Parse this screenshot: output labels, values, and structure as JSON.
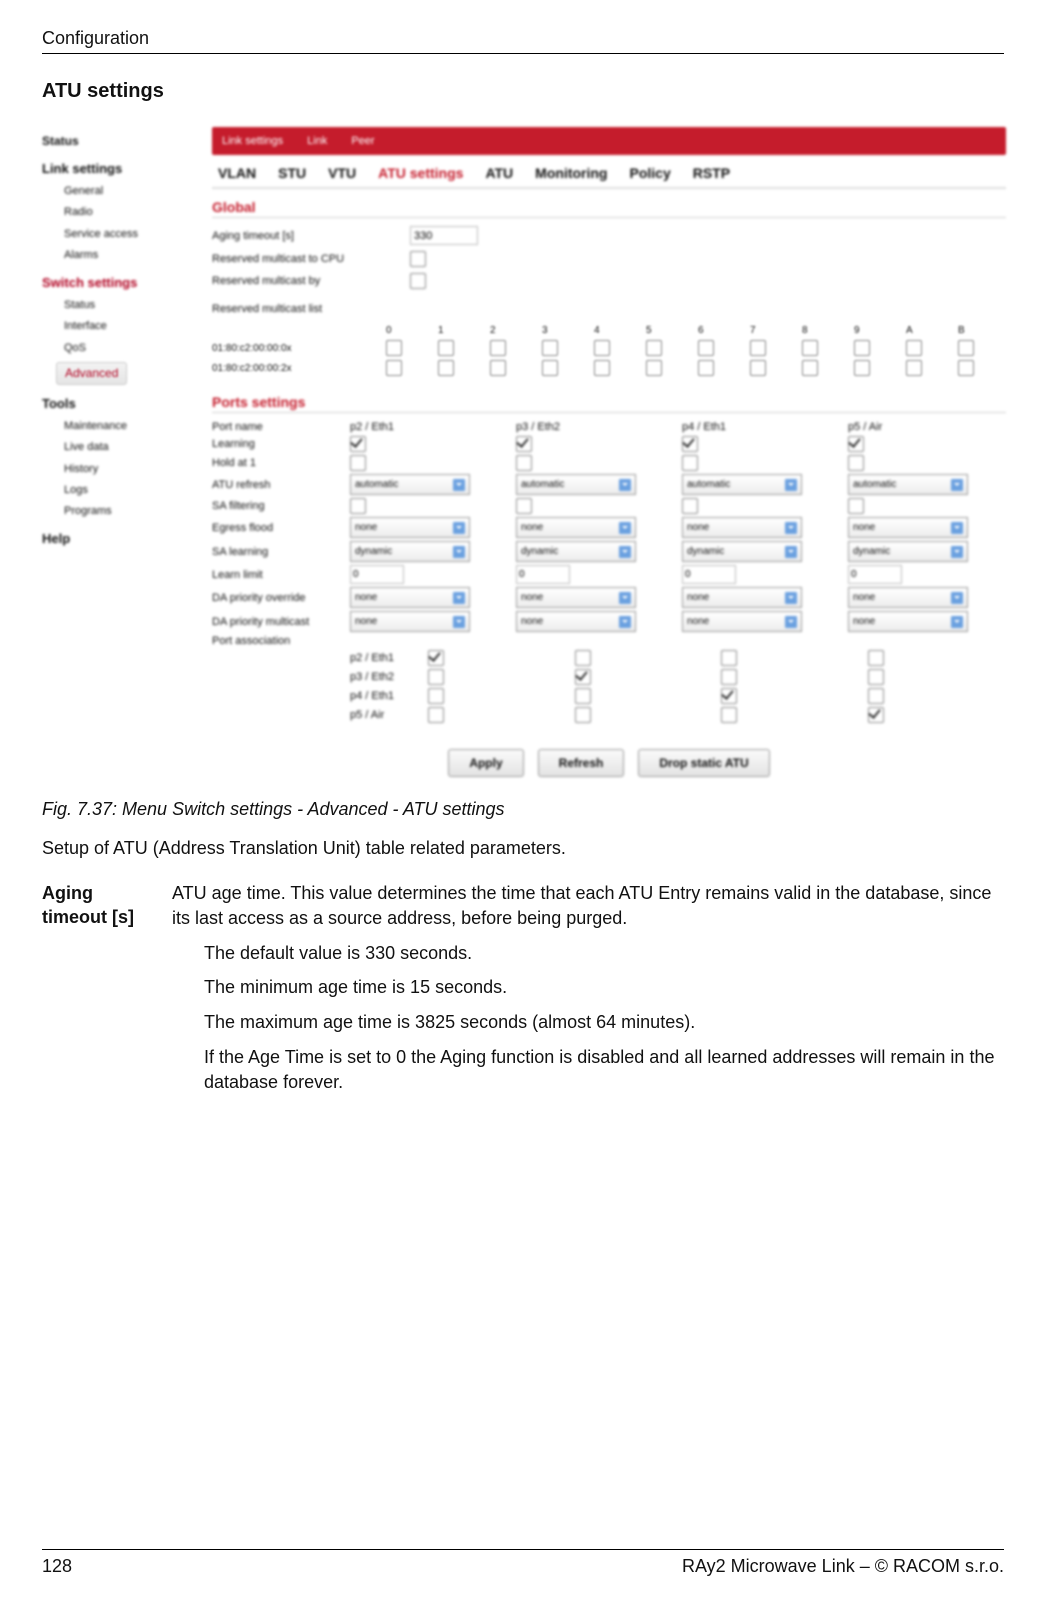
{
  "header": {
    "running": "Configuration",
    "title": "ATU settings"
  },
  "sidebar": {
    "top": "Status",
    "groups": [
      {
        "label": "Link settings",
        "active": false,
        "items": [
          "General",
          "Radio",
          "Service access",
          "Alarms"
        ]
      },
      {
        "label": "Switch settings",
        "active": true,
        "items": [
          "Status",
          "Interface",
          "QoS",
          "Advanced"
        ],
        "activeItem": "Advanced"
      },
      {
        "label": "Tools",
        "active": false,
        "items": [
          "Maintenance",
          "Live data",
          "History",
          "Logs",
          "Programs"
        ]
      }
    ],
    "help": "Help"
  },
  "screenshot": {
    "topbar": [
      "Link settings",
      "Link",
      "Peer"
    ],
    "tabs": [
      "VLAN",
      "STU",
      "VTU",
      "ATU settings",
      "ATU",
      "Monitoring",
      "Policy",
      "RSTP"
    ],
    "activeTab": "ATU settings",
    "globalHeading": "Global",
    "global": {
      "aging_label": "Aging timeout [s]",
      "aging_value": "330",
      "learn2all_label": "Reserved multicast to CPU",
      "learn2all_checked": false,
      "refresh_label": "Reserved multicast by",
      "refresh_checked": false
    },
    "bits": {
      "title": "Reserved multicast list",
      "cols": [
        "0",
        "1",
        "2",
        "3",
        "4",
        "5",
        "6",
        "7",
        "8",
        "9",
        "A",
        "B"
      ],
      "rows": [
        {
          "mac": "01:80:c2:00:00:0x",
          "checked": [
            false,
            false,
            false,
            false,
            false,
            false,
            false,
            false,
            false,
            false,
            false,
            false
          ]
        },
        {
          "mac": "01:80:c2:00:00:2x",
          "checked": [
            false,
            false,
            false,
            false,
            false,
            false,
            false,
            false,
            false,
            false,
            false,
            false
          ]
        }
      ]
    },
    "portsHeading": "Ports settings",
    "ports": {
      "headers": [
        "Port name",
        "p2 / Eth1",
        "p3 / Eth2",
        "p4 / Eth1",
        "p5 / Air"
      ],
      "rows": [
        {
          "label": "Learning",
          "type": "cb",
          "values": [
            true,
            true,
            true,
            true
          ]
        },
        {
          "label": "Hold at 1",
          "type": "cb",
          "values": [
            false,
            false,
            false,
            false
          ]
        },
        {
          "label": "ATU refresh",
          "type": "sel",
          "values": [
            "automatic",
            "automatic",
            "automatic",
            "automatic"
          ]
        },
        {
          "label": "SA filtering",
          "type": "cb",
          "values": [
            false,
            false,
            false,
            false
          ]
        },
        {
          "label": "Egress flood",
          "type": "sel",
          "values": [
            "none",
            "none",
            "none",
            "none"
          ]
        },
        {
          "label": "SA learning",
          "type": "sel",
          "values": [
            "dynamic",
            "dynamic",
            "dynamic",
            "dynamic"
          ]
        },
        {
          "label": "Learn limit",
          "type": "txt",
          "values": [
            "0",
            "0",
            "0",
            "0"
          ]
        },
        {
          "label": "DA priority override",
          "type": "sel",
          "values": [
            "none",
            "none",
            "none",
            "none"
          ]
        },
        {
          "label": "DA priority multicast",
          "type": "sel",
          "values": [
            "none",
            "none",
            "none",
            "none"
          ]
        }
      ],
      "assoc_label": "Port association",
      "assoc_ports": [
        "p2 / Eth1",
        "p3 / Eth2",
        "p4 / Eth1",
        "p5 / Air"
      ],
      "assoc": [
        [
          true,
          false,
          false,
          false
        ],
        [
          false,
          true,
          false,
          false
        ],
        [
          false,
          false,
          true,
          false
        ],
        [
          false,
          false,
          false,
          true
        ]
      ]
    },
    "buttons": [
      "Apply",
      "Refresh",
      "Drop static ATU"
    ]
  },
  "caption": "Fig. 7.37: Menu Switch settings - Advanced - ATU settings",
  "intro": "Setup of ATU (Address Translation Unit) table related parameters.",
  "def": {
    "term1": "Aging",
    "term2": "timeout [s]",
    "p1": "ATU age time. This value determines the time that each ATU Entry remains valid in the database, since its last access as a source address, before being purged.",
    "p2": "The default value is 330 seconds.",
    "p3": "The minimum age time is 15 seconds.",
    "p4": "The maximum age time is 3825 seconds (almost 64 minutes).",
    "p5": "If the Age Time is set to 0 the Aging function is disabled and all learned addresses will remain in the database forever."
  },
  "footer": {
    "page": "128",
    "right": "RAy2 Microwave Link – © RACOM s.r.o."
  }
}
